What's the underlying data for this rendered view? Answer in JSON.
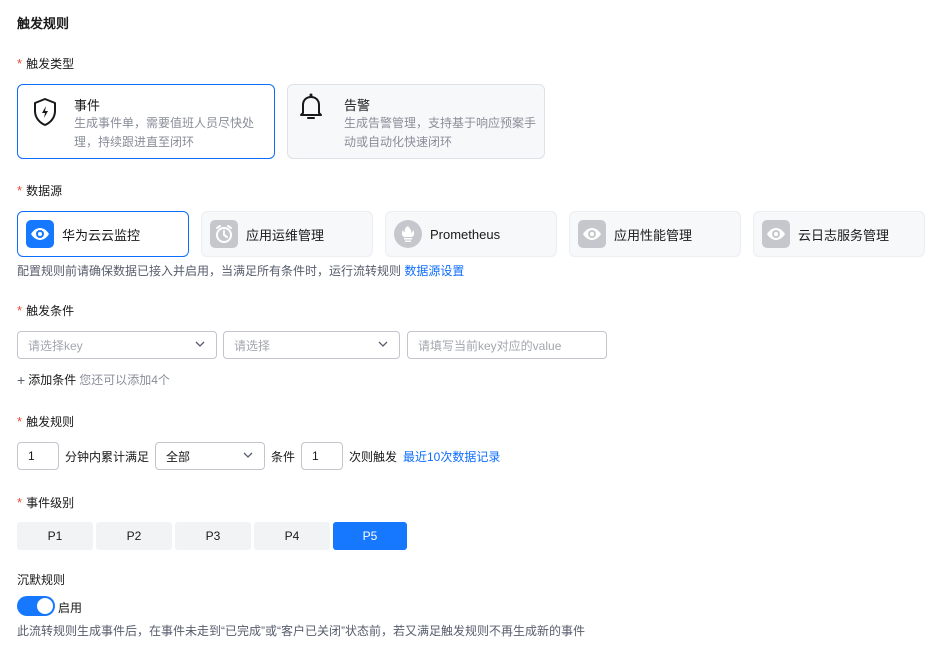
{
  "header": {
    "title": "触发规则"
  },
  "trigger_type": {
    "label": "触发类型",
    "options": [
      {
        "title": "事件",
        "desc_line1": "生成事件单，需要值班人员尽快处",
        "desc_line2": "理，持续跟进直至闭环",
        "icon": "shield-lightning-icon",
        "selected": true
      },
      {
        "title": "告警",
        "desc_line1": "生成告警管理，支持基于响应预案手",
        "desc_line2": "动或自动化快速闭环",
        "icon": "bell-icon",
        "selected": false
      }
    ]
  },
  "data_source": {
    "label": "数据源",
    "options": [
      {
        "label": "华为云云监控",
        "icon": "eye-icon",
        "selected": true
      },
      {
        "label": "应用运维管理",
        "icon": "alarm-clock-icon",
        "selected": false
      },
      {
        "label": "Prometheus",
        "icon": "prometheus-icon",
        "selected": false
      },
      {
        "label": "应用性能管理",
        "icon": "eye-icon",
        "selected": false
      },
      {
        "label": "云日志服务管理",
        "icon": "eye-icon",
        "selected": false
      }
    ],
    "hint": "配置规则前请确保数据已接入并启用，当满足所有条件时，运行流转规则",
    "hint_link": "数据源设置"
  },
  "conditions": {
    "label": "触发条件",
    "key_placeholder": "请选择key",
    "op_placeholder": "请选择",
    "value_placeholder": "请填写当前key对应的value",
    "add_label": "添加条件",
    "add_hint": "您还可以添加4个"
  },
  "trigger_rule": {
    "label": "触发规则",
    "minutes": "1",
    "text_minutes": "分钟内累计满足",
    "scope": "全部",
    "text_condition": "条件",
    "times": "1",
    "text_times": "次则触发",
    "link": "最近10次数据记录"
  },
  "level": {
    "label": "事件级别",
    "options": [
      "P1",
      "P2",
      "P3",
      "P4",
      "P5"
    ],
    "selected": "P5"
  },
  "silence": {
    "label": "沉默规则",
    "toggle_label": "启用",
    "enabled": true,
    "hint": "此流转规则生成事件后，在事件未走到“已完成”或“客户已关闭”状态前，若又满足触发规则不再生成新的事件"
  },
  "colors": {
    "accent": "#1677ff",
    "required": "#e84738",
    "link": "#0d6efd"
  }
}
